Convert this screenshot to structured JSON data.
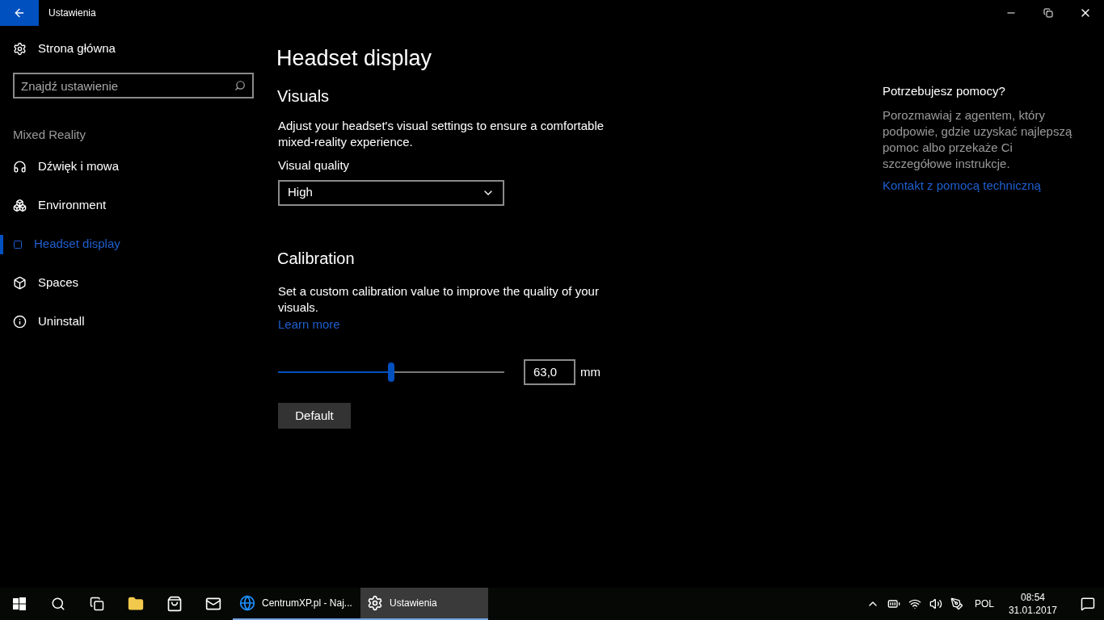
{
  "window": {
    "title": "Ustawienia"
  },
  "sidebar": {
    "home": "Strona główna",
    "search": {
      "placeholder": "Znajdź ustawienie"
    },
    "section": "Mixed Reality",
    "items": [
      {
        "label": "Dźwięk i mowa",
        "selected": false
      },
      {
        "label": "Environment",
        "selected": false
      },
      {
        "label": "Headset display",
        "selected": true
      },
      {
        "label": "Spaces",
        "selected": false
      },
      {
        "label": "Uninstall",
        "selected": false
      }
    ]
  },
  "page": {
    "title": "Headset display",
    "visuals": {
      "heading": "Visuals",
      "description": "Adjust your headset's visual settings to ensure a comfortable mixed-reality experience.",
      "quality_label": "Visual quality",
      "quality_value": "High"
    },
    "calibration": {
      "heading": "Calibration",
      "description": "Set a custom calibration value to improve the quality of your visuals.",
      "link": "Learn more",
      "slider": {
        "level": 0.5
      },
      "value": "63,0",
      "unit": "mm",
      "button": "Default"
    }
  },
  "help": {
    "heading": "Potrzebujesz pomocy?",
    "text": "Porozmawiaj z agentem, który podpowie, gdzie uzyskać najlepszą pomoc albo przekaże Ci szczegółowe instrukcje.",
    "link": "Kontakt z pomocą techniczną"
  },
  "taskbar": {
    "apps": [
      {
        "label": "CentrumXP.pl - Naj...",
        "selected": false
      },
      {
        "label": "Ustawienia",
        "selected": true
      }
    ],
    "language": "POL",
    "time": "08:54",
    "date": "31.01.2017"
  }
}
